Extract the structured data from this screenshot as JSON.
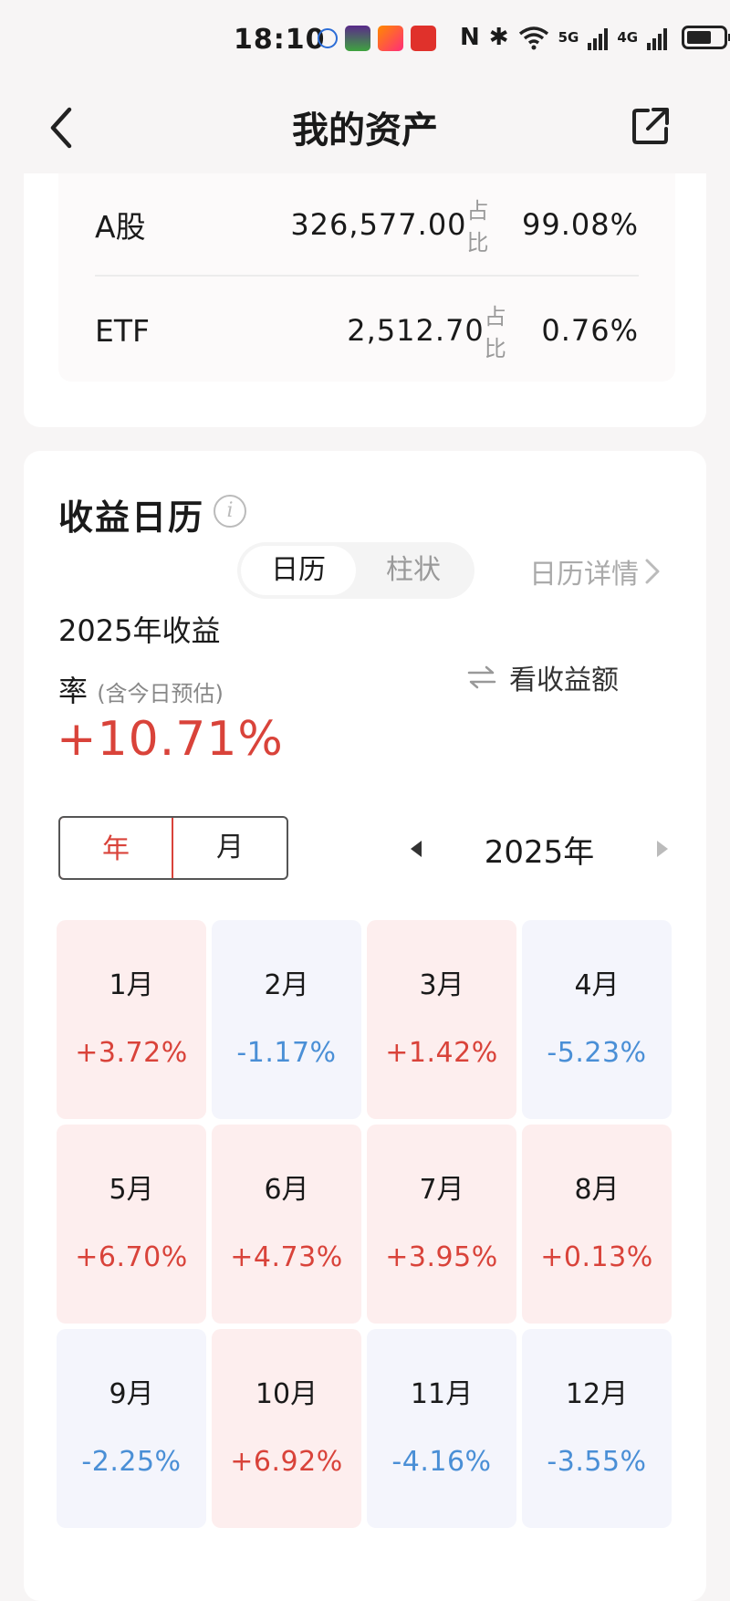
{
  "status_bar": {
    "time": "18:10",
    "network_5g": "5G",
    "network_4g": "4G"
  },
  "nav": {
    "title": "我的资产"
  },
  "assets": [
    {
      "name": "A股",
      "amount": "326,577.00",
      "ratio_label": "占比",
      "ratio": "99.08%"
    },
    {
      "name": "ETF",
      "amount": "2,512.70",
      "ratio_label": "占比",
      "ratio": "0.76%"
    }
  ],
  "calendar": {
    "title": "收益日历",
    "tabs": [
      "日历",
      "柱状"
    ],
    "detail_link": "日历详情",
    "rate_title": "2025年收益率",
    "rate_note": "(含今日预估)",
    "rate_value": "+10.71%",
    "switch_label": "看收益额",
    "toggle": [
      "年",
      "月"
    ],
    "year_label": "2025年",
    "months": [
      {
        "month": "1月",
        "value": "+3.72%",
        "trend": "up"
      },
      {
        "month": "2月",
        "value": "-1.17%",
        "trend": "down"
      },
      {
        "month": "3月",
        "value": "+1.42%",
        "trend": "up"
      },
      {
        "month": "4月",
        "value": "-5.23%",
        "trend": "down"
      },
      {
        "month": "5月",
        "value": "+6.70%",
        "trend": "up"
      },
      {
        "month": "6月",
        "value": "+4.73%",
        "trend": "up"
      },
      {
        "month": "7月",
        "value": "+3.95%",
        "trend": "up"
      },
      {
        "month": "8月",
        "value": "+0.13%",
        "trend": "up"
      },
      {
        "month": "9月",
        "value": "-2.25%",
        "trend": "down"
      },
      {
        "month": "10月",
        "value": "+6.92%",
        "trend": "up"
      },
      {
        "month": "11月",
        "value": "-4.16%",
        "trend": "down"
      },
      {
        "month": "12月",
        "value": "-3.55%",
        "trend": "down"
      }
    ]
  },
  "colors": {
    "up": "#d9433a",
    "down": "#4a8fd6",
    "up_bg": "#fdeeee",
    "down_bg": "#f4f5fc"
  }
}
